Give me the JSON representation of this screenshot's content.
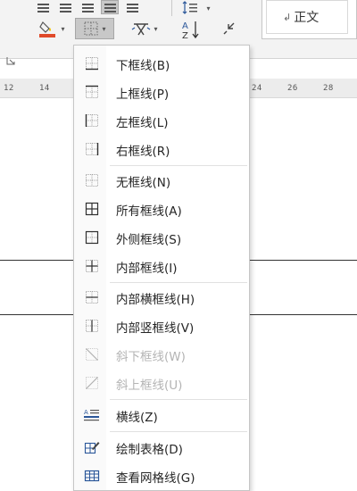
{
  "ribbon": {
    "style_preview_label": "正文",
    "style_preview_mark": "↲",
    "dropdown_arrow": "▾",
    "sort_label": "A Z"
  },
  "ruler": {
    "ticks": [
      "12",
      "14",
      "24",
      "26",
      "28"
    ]
  },
  "border_menu": {
    "items": [
      {
        "label": "下框线(B)",
        "icon": "bottom-border-icon",
        "enabled": true
      },
      {
        "label": "上框线(P)",
        "icon": "top-border-icon",
        "enabled": true
      },
      {
        "label": "左框线(L)",
        "icon": "left-border-icon",
        "enabled": true
      },
      {
        "label": "右框线(R)",
        "icon": "right-border-icon",
        "enabled": true
      },
      {
        "label": "无框线(N)",
        "icon": "no-border-icon",
        "enabled": true
      },
      {
        "label": "所有框线(A)",
        "icon": "all-borders-icon",
        "enabled": true
      },
      {
        "label": "外侧框线(S)",
        "icon": "outside-borders-icon",
        "enabled": true
      },
      {
        "label": "内部框线(I)",
        "icon": "inside-borders-icon",
        "enabled": true
      },
      {
        "label": "内部横框线(H)",
        "icon": "inside-horizontal-border-icon",
        "enabled": true
      },
      {
        "label": "内部竖框线(V)",
        "icon": "inside-vertical-border-icon",
        "enabled": true
      },
      {
        "label": "斜下框线(W)",
        "icon": "diagonal-down-border-icon",
        "enabled": false
      },
      {
        "label": "斜上框线(U)",
        "icon": "diagonal-up-border-icon",
        "enabled": false
      },
      {
        "label": "横线(Z)",
        "icon": "horizontal-line-icon",
        "enabled": true
      },
      {
        "label": "绘制表格(D)",
        "icon": "draw-table-icon",
        "enabled": true
      },
      {
        "label": "查看网格线(G)",
        "icon": "view-gridlines-icon",
        "enabled": true
      }
    ]
  },
  "colors": {
    "accent": "#2b579a",
    "icon_gray": "#8a8a8a",
    "disabled_text": "#b4b4b4",
    "shading_yellow": "#f5c400",
    "shading_red": "#e04a2a"
  }
}
